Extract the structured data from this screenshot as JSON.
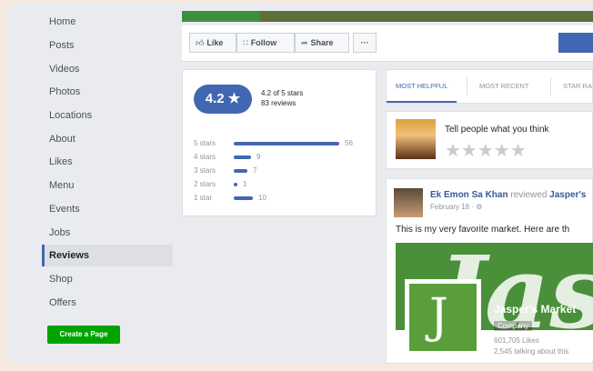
{
  "sidebar": {
    "items": [
      {
        "label": "Home"
      },
      {
        "label": "Posts"
      },
      {
        "label": "Videos"
      },
      {
        "label": "Photos"
      },
      {
        "label": "Locations"
      },
      {
        "label": "About"
      },
      {
        "label": "Likes"
      },
      {
        "label": "Menu"
      },
      {
        "label": "Events"
      },
      {
        "label": "Jobs"
      },
      {
        "label": "Reviews"
      },
      {
        "label": "Shop"
      },
      {
        "label": "Offers"
      }
    ],
    "active_item": "Reviews",
    "create_page_label": "Create a Page"
  },
  "action_bar": {
    "like_label": "Like",
    "follow_label": "Follow",
    "share_label": "Share",
    "more_label": "···"
  },
  "rating": {
    "score": "4.2 ★",
    "summary_line1": "4.2 of 5 stars",
    "summary_line2": "83 reviews",
    "bars": [
      {
        "label": "5 stars",
        "count": "56",
        "value": 56
      },
      {
        "label": "4 stars",
        "count": "9",
        "value": 9
      },
      {
        "label": "3 stars",
        "count": "7",
        "value": 7
      },
      {
        "label": "2 stars",
        "count": "1",
        "value": 1
      },
      {
        "label": "1 star",
        "count": "10",
        "value": 10
      }
    ]
  },
  "review_tabs": {
    "tabs": [
      "MOST HELPFUL",
      "MOST RECENT",
      "STAR RA"
    ],
    "active": "MOST HELPFUL"
  },
  "tell": {
    "prompt": "Tell people what you think",
    "stars": "★★★★★"
  },
  "post": {
    "author": "Ek Emon Sa Khan",
    "verb": "reviewed",
    "page": "Jasper's",
    "date": "February 18 · ⚙",
    "text": "This is my very favorite market. Here are th",
    "image_script": "Jasp",
    "page_name": "Jasper's Market",
    "category": "Company",
    "likes": "601,705 Likes",
    "talking": "2,545 talking about this"
  },
  "colors": {
    "brand_blue": "#4267b2",
    "create_green": "#00a400",
    "background": "#e9ebee"
  }
}
